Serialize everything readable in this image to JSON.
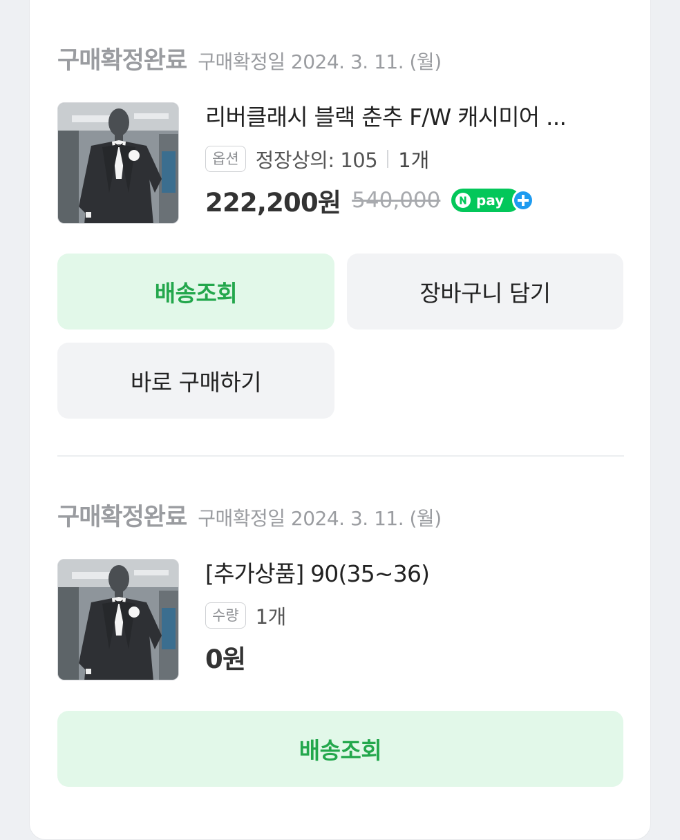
{
  "orders": [
    {
      "status": "구매확정완료",
      "confirm_date": "구매확정일 2024. 3. 11. (월)",
      "product_name": "리버클래시 블랙 춘추 F/W 캐시미어 ...",
      "option_tag": "옵션",
      "option_value": "정장상의: 105",
      "quantity": "1개",
      "price": "222,200원",
      "original_price": "540,000",
      "payment_badge": "pay",
      "buttons": {
        "shipping": "배송조회",
        "cart": "장바구니 담기",
        "buy_now": "바로 구매하기"
      }
    },
    {
      "status": "구매확정완료",
      "confirm_date": "구매확정일 2024. 3. 11. (월)",
      "product_name": "[추가상품] 90(35~36)",
      "option_tag": "수량",
      "quantity": "1개",
      "price": "0원",
      "buttons": {
        "shipping": "배송조회"
      }
    }
  ],
  "colors": {
    "accent_green": "#23a74c",
    "green_button_bg": "#e2f8e9",
    "gray_button_bg": "#f2f3f5",
    "npay_green": "#03c75a",
    "npay_plus_blue": "#1e9bf0"
  },
  "icons": [
    "npay-logo",
    "npay-plus-icon"
  ]
}
